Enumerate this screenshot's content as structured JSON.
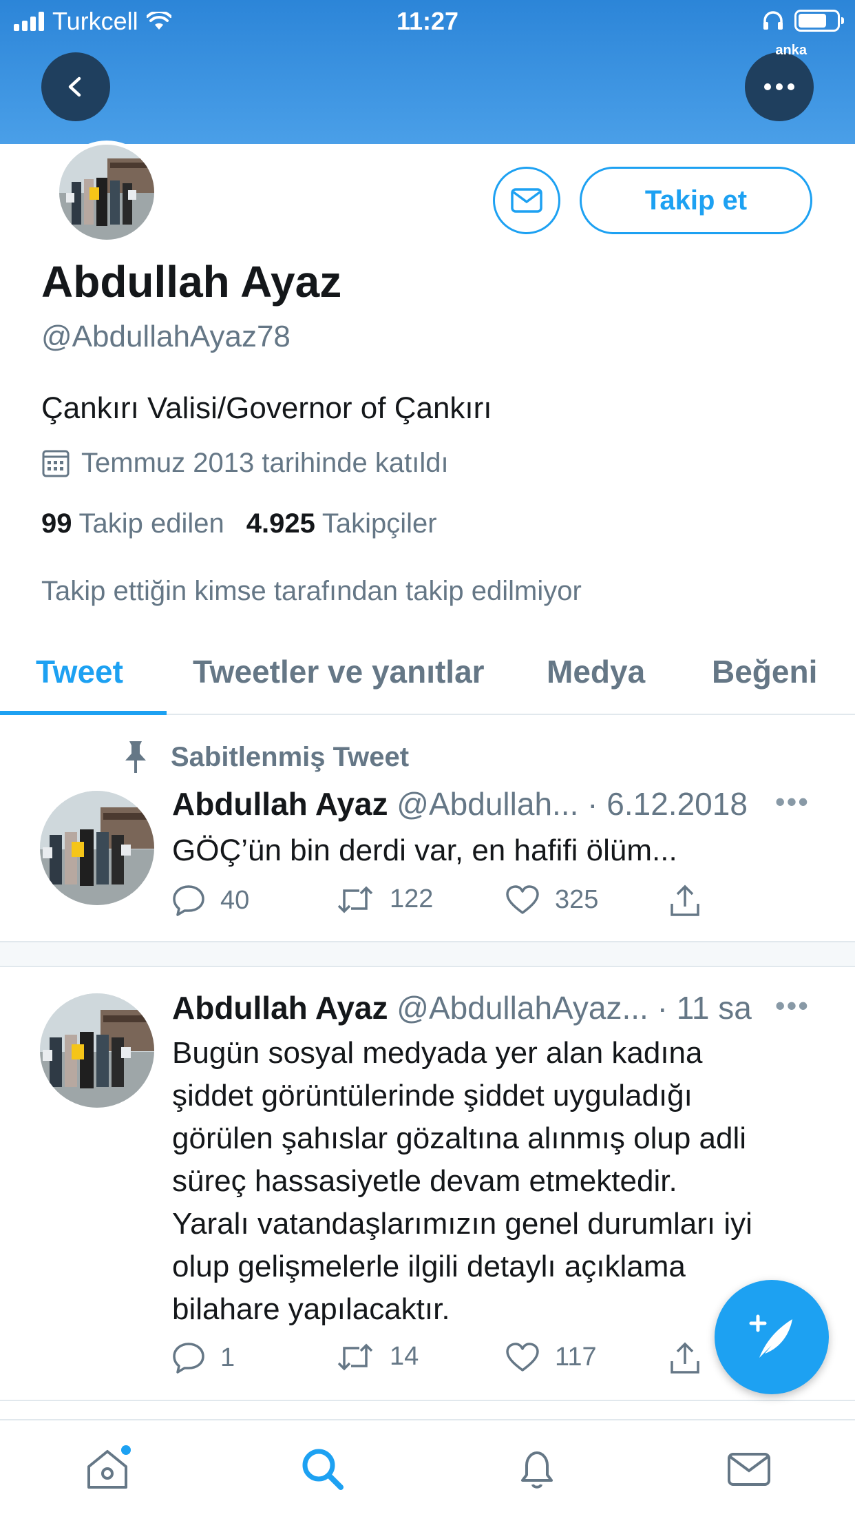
{
  "status_bar": {
    "carrier": "Turkcell",
    "time": "11:27"
  },
  "header": {
    "watermark": "anka"
  },
  "profile": {
    "name": "Abdullah Ayaz",
    "handle": "@AbdullahAyaz78",
    "bio": "Çankırı Valisi/Governor of Çankırı",
    "joined": "Temmuz 2013 tarihinde katıldı",
    "following_count": "99",
    "following_label": "Takip edilen",
    "followers_count": "4.925",
    "followers_label": "Takipçiler",
    "follow_info": "Takip ettiğin kimse tarafından takip edilmiyor",
    "follow_button": "Takip et"
  },
  "tabs": [
    {
      "label": "Tweet",
      "active": true
    },
    {
      "label": "Tweetler ve yanıtlar",
      "active": false
    },
    {
      "label": "Medya",
      "active": false
    },
    {
      "label": "Beğeni",
      "active": false
    }
  ],
  "tweets": [
    {
      "pinned_label": "Sabitlenmiş Tweet",
      "name": "Abdullah Ayaz",
      "handle": "@Abdullah...",
      "time": "· 6.12.2018",
      "text": "GÖÇ’ün bin derdi var, en hafifi ölüm...",
      "replies": "40",
      "retweets": "122",
      "likes": "325"
    },
    {
      "name": "Abdullah Ayaz",
      "handle": "@AbdullahAyaz...",
      "time": "· 11 sa",
      "text_lines": [
        "Bugün sosyal medyada yer alan kadına",
        "şiddet görüntülerinde şiddet uyguladığı",
        "görülen şahıslar gözaltına alınmış olup adli",
        "süreç hassasiyetle devam etmektedir.",
        "Yaralı vatandaşlarımızın genel durumları iyi",
        "olup gelişmelerle ilgili detaylı açıklama",
        "bilahare yapılacaktır."
      ],
      "replies": "1",
      "retweets": "14",
      "likes": "117"
    }
  ],
  "colors": {
    "accent": "#1da1f2",
    "header_blue": "#2c85d8",
    "secondary_text": "#657786"
  }
}
